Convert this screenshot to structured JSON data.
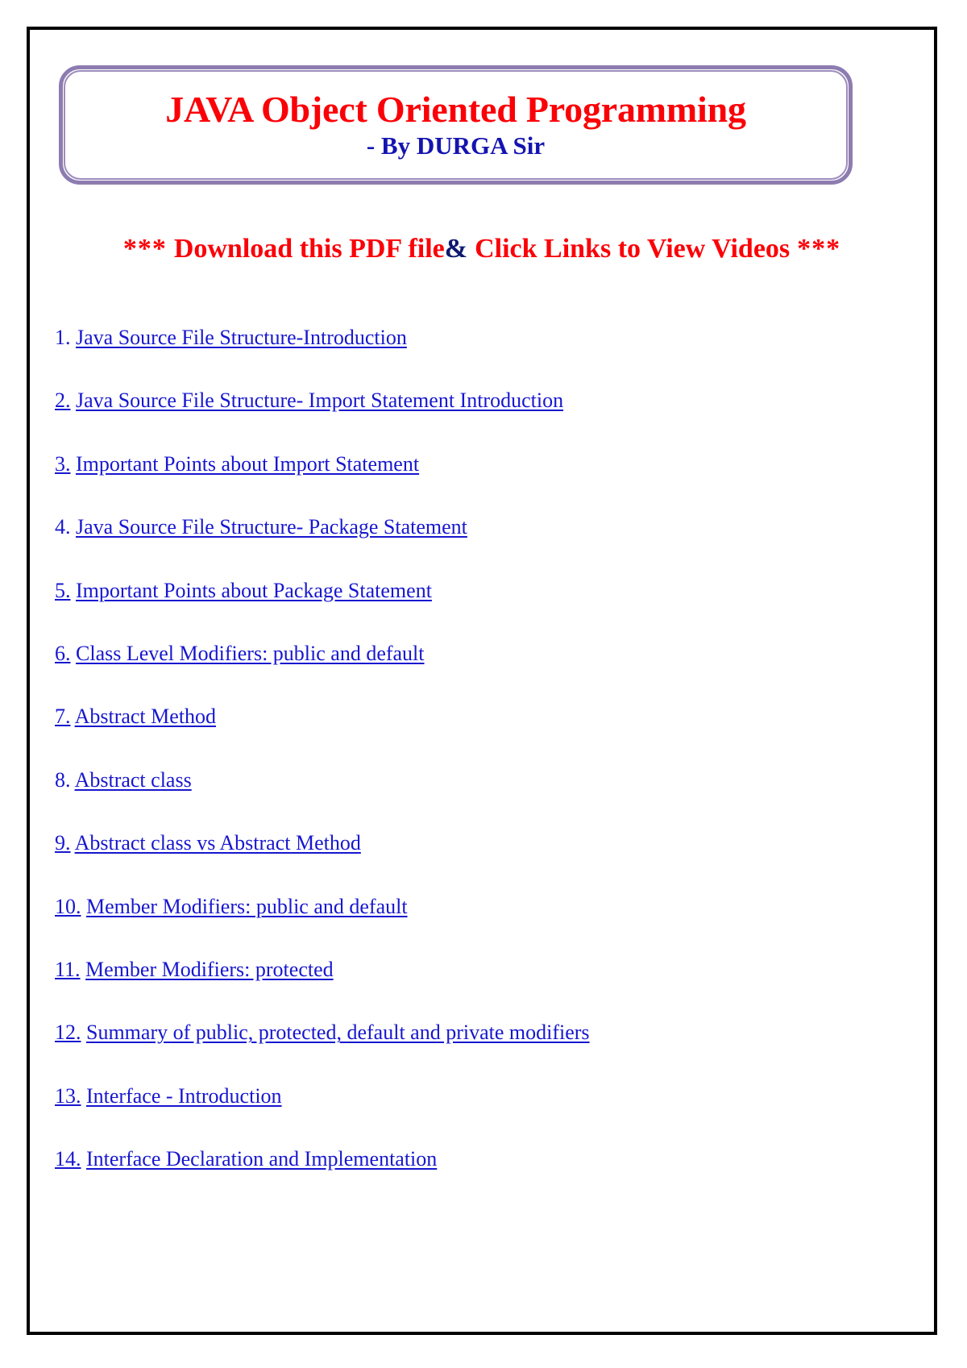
{
  "document": {
    "title": "JAVA Object Oriented Programming",
    "subtitle": "- By DURGA Sir",
    "banner": {
      "stars_left": "***",
      "text_before_amp": "Download this PDF file",
      "amp": "&",
      "text_after_amp": "Click Links to View Videos",
      "stars_right": "***"
    },
    "colors": {
      "title_red": "#fb0007",
      "subtitle_blue": "#1414b0",
      "link_blue": "#1717cf",
      "amp_navy": "#0d1a6e",
      "title_border_purple": "#8d7cb0",
      "page_border_black": "#000000"
    },
    "toc": [
      {
        "number": "1.",
        "label": "Java Source File Structure-Introduction"
      },
      {
        "number": "2.",
        "label": "Java Source File Structure- Import Statement Introduction"
      },
      {
        "number": "3.",
        "label": "Important Points about Import Statement"
      },
      {
        "number": "4.",
        "label": "Java Source File Structure- Package Statement"
      },
      {
        "number": "5.",
        "label": "Important Points about Package Statement"
      },
      {
        "number": "6.",
        "label": "Class Level Modifiers: public and default"
      },
      {
        "number": "7.",
        "label": "Abstract Method"
      },
      {
        "number": "8.",
        "label": "Abstract class"
      },
      {
        "number": "9.",
        "label": "Abstract class vs Abstract Method"
      },
      {
        "number": "10.",
        "label": "Member Modifiers: public and default"
      },
      {
        "number": "11.",
        "label": "Member Modifiers: protected"
      },
      {
        "number": "12.",
        "label": "Summary of public, protected, default and private modifiers"
      },
      {
        "number": "13.",
        "label": "Interface - Introduction"
      },
      {
        "number": "14.",
        "label": "Interface Declaration and Implementation"
      }
    ]
  }
}
